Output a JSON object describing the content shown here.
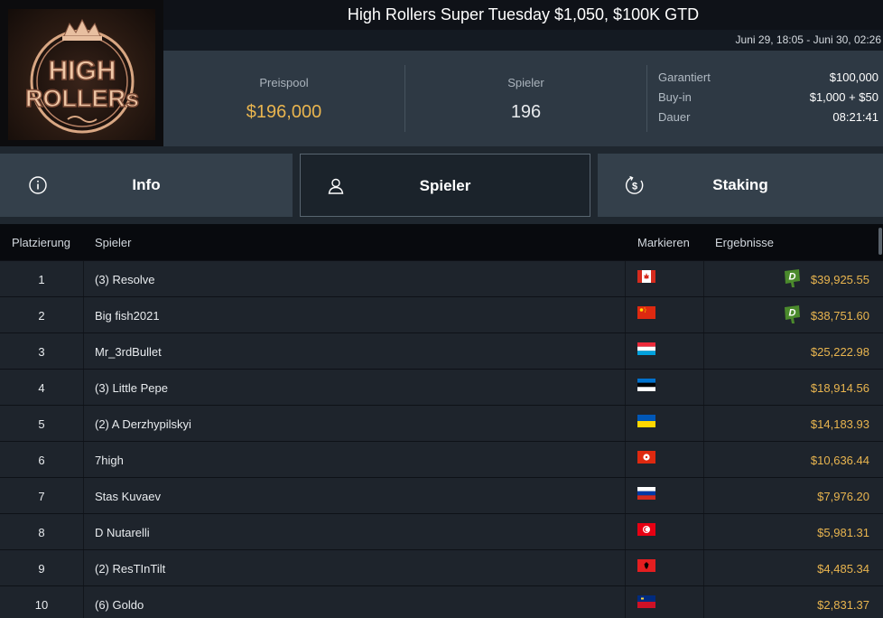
{
  "logo": {
    "alt": "HIGH ROLLERS",
    "line1": "HIGH",
    "line2": "ROLLERs"
  },
  "header": {
    "title": "High Rollers Super Tuesday $1,050, $100K GTD",
    "date_range": "Juni 29, 18:05 - Juni 30, 02:26"
  },
  "stats": {
    "prizepool_label": "Preispool",
    "prizepool_value": "$196,000",
    "players_label": "Spieler",
    "players_value": "196",
    "details": [
      {
        "label": "Garantiert",
        "value": "$100,000"
      },
      {
        "label": "Buy-in",
        "value": "$1,000 + $50"
      },
      {
        "label": "Dauer",
        "value": "08:21:41"
      }
    ]
  },
  "tabs": [
    {
      "label": "Info",
      "icon": "info-icon",
      "active": false
    },
    {
      "label": "Spieler",
      "icon": "user-icon",
      "active": true
    },
    {
      "label": "Staking",
      "icon": "staking-dollar-icon",
      "active": false
    }
  ],
  "table": {
    "headers": {
      "rank": "Platzierung",
      "player": "Spieler",
      "flag": "Markieren",
      "result": "Ergebnisse"
    },
    "rows": [
      {
        "rank": "1",
        "player": "(3) Resolve",
        "flag": "canada",
        "result": "$39,925.55",
        "badge": "D"
      },
      {
        "rank": "2",
        "player": "Big fish2021",
        "flag": "china",
        "result": "$38,751.60",
        "badge": "D"
      },
      {
        "rank": "3",
        "player": "Mr_3rdBullet",
        "flag": "luxembourg",
        "result": "$25,222.98",
        "badge": ""
      },
      {
        "rank": "4",
        "player": "(3) Little Pepe",
        "flag": "estonia",
        "result": "$18,914.56",
        "badge": ""
      },
      {
        "rank": "5",
        "player": "(2) A Derzhypilskyi",
        "flag": "ukraine",
        "result": "$14,183.93",
        "badge": ""
      },
      {
        "rank": "6",
        "player": "7high",
        "flag": "hong-kong",
        "result": "$10,636.44",
        "badge": ""
      },
      {
        "rank": "7",
        "player": "Stas Kuvaev",
        "flag": "russia",
        "result": "$7,976.20",
        "badge": ""
      },
      {
        "rank": "8",
        "player": "D Nutarelli",
        "flag": "tunisia",
        "result": "$5,981.31",
        "badge": ""
      },
      {
        "rank": "9",
        "player": "(2) ResTInTilt",
        "flag": "albania",
        "result": "$4,485.34",
        "badge": ""
      },
      {
        "rank": "10",
        "player": "(6) Goldo",
        "flag": "liechtenstein",
        "result": "$2,831.37",
        "badge": ""
      }
    ]
  },
  "colors": {
    "accent_gold": "#e9b54f",
    "badge_green": "#4b8a2c"
  }
}
